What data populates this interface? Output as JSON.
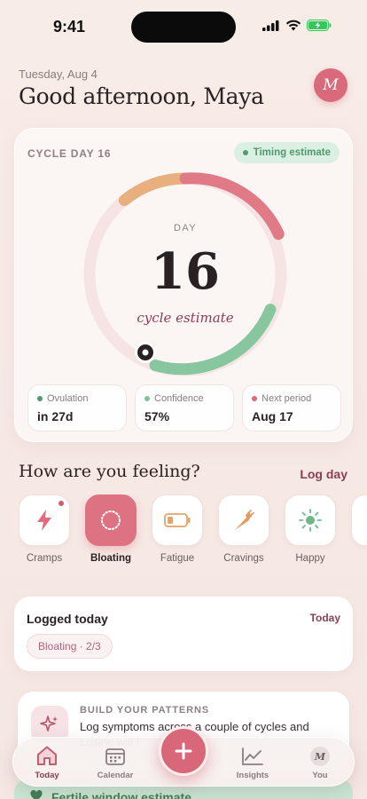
{
  "status_bar": {
    "time": "9:41"
  },
  "header": {
    "date": "Tuesday, Aug 4",
    "greeting": "Good afternoon, Maya",
    "avatar_initial": "M"
  },
  "cycle": {
    "label": "CYCLE DAY 16",
    "badge": "Timing estimate",
    "ring_label": "DAY",
    "day": "16",
    "subtitle": "cycle estimate",
    "stats": [
      {
        "label": "Ovulation",
        "value": "in 27d",
        "color": "#4f9a6d"
      },
      {
        "label": "Confidence",
        "value": "57%",
        "color": "#7fc39b"
      },
      {
        "label": "Next period",
        "value": "Aug 17",
        "color": "#d86a7c"
      }
    ]
  },
  "feelings": {
    "title": "How are you feeling?",
    "action": "Log day",
    "moods": [
      {
        "label": "Cramps",
        "icon": "lightning-icon",
        "active": false
      },
      {
        "label": "Bloating",
        "icon": "dotted-circle-icon",
        "active": true
      },
      {
        "label": "Fatigue",
        "icon": "battery-low-icon",
        "active": false
      },
      {
        "label": "Cravings",
        "icon": "carrot-icon",
        "active": false
      },
      {
        "label": "Happy",
        "icon": "sun-icon",
        "active": false
      }
    ]
  },
  "logged_today": {
    "title": "Logged today",
    "action": "Today",
    "chip": "Bloating · 2/3"
  },
  "patterns": {
    "kicker": "BUILD YOUR PATTERNS",
    "text": "Log symptoms across a couple of cycles and Lusine will f"
  },
  "fertile_banner": {
    "text": "Fertile window estimate"
  },
  "tabbar": {
    "today": "Today",
    "calendar": "Calendar",
    "insights": "Insights",
    "you": "You",
    "you_initial": "M"
  },
  "colors": {
    "accent": "#d86a7c",
    "brand_dark": "#8c3d52",
    "green": "#4f9a6d",
    "ring_orange": "#e8b07f",
    "ring_rose": "#df7a86",
    "ring_green": "#88c6a0"
  }
}
